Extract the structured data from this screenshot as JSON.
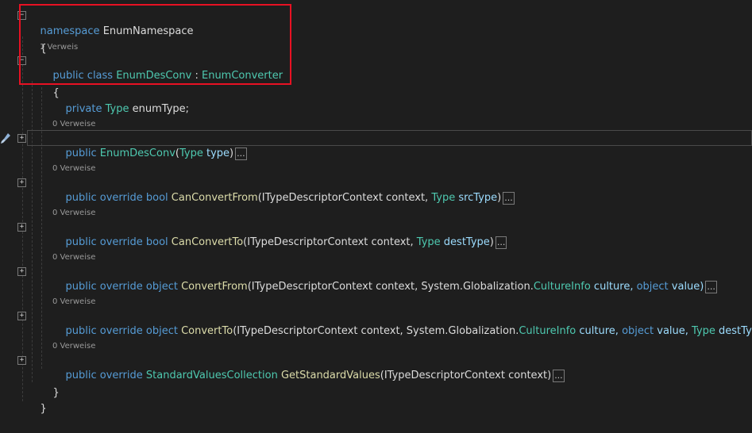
{
  "code": {
    "l1": {
      "kw": "namespace",
      "name": "EnumNamespace"
    },
    "l2": "{",
    "lens1": "1 Verweis",
    "l3": {
      "kw1": "public",
      "kw2": "class",
      "cls": "EnumDesConv",
      "sep": " : ",
      "base": "EnumConverter"
    },
    "l4": "{",
    "l5": {
      "kw": "private",
      "type": "Type",
      "field": "enumType;"
    },
    "lens2": "0 Verweise",
    "l6": {
      "kw": "public",
      "name": "EnumDesConv",
      "open": "(",
      "ptype": "Type",
      "pname": "type",
      "close": ")"
    },
    "lens3": "0 Verweise",
    "l7": {
      "kw": "public override bool",
      "name": "CanConvertFrom",
      "p1": "(ITypeDescriptorContext context, ",
      "ptype": "Type",
      "pname": "srcType",
      "close": ")"
    },
    "lens4": "0 Verweise",
    "l8": {
      "kw": "public override bool",
      "name": "CanConvertTo",
      "p1": "(ITypeDescriptorContext context, ",
      "ptype": "Type",
      "pname": "destType",
      "close": ")"
    },
    "lens5": "0 Verweise",
    "l9": {
      "kw": "public override object",
      "name": "ConvertFrom",
      "p1": "(ITypeDescriptorContext context, System.Globalization.",
      "ctype": "CultureInfo",
      "p2": " culture, ",
      "okw": "object",
      "p3": " value)"
    },
    "lens6": "0 Verweise",
    "l10": {
      "kw": "public override object",
      "name": "ConvertTo",
      "p1": "(ITypeDescriptorContext context, System.Globalization.",
      "ctype": "CultureInfo",
      "p2": " culture, ",
      "okw": "object",
      "p3": " value, ",
      "ptype": "Type",
      "pname": "destType",
      "close": ")"
    },
    "lens7": "0 Verweise",
    "l11": {
      "kw": "public override",
      "rtype": "StandardValuesCollection",
      "name": "GetStandardValues",
      "p1": "(ITypeDescriptorContext context)"
    },
    "l12": "}",
    "l13": "}",
    "ellipsis": "..."
  },
  "fold": {
    "collapse": "−",
    "expand": "+"
  },
  "colors": {
    "keyword": "#569cd6",
    "type": "#4ec9b0",
    "method": "#dcdcaa",
    "param": "#9cdcfe",
    "highlight_box": "#e81123"
  }
}
